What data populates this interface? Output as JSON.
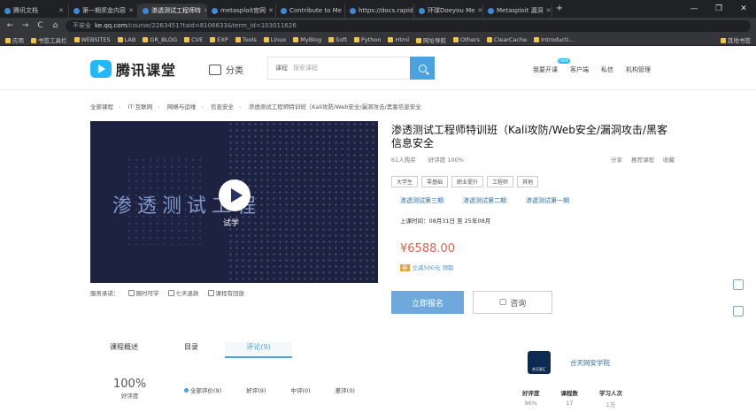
{
  "browser": {
    "tabs": [
      {
        "label": "腾讯文档"
      },
      {
        "label": "第一期奖金内容"
      },
      {
        "label": "渗透测试工程师特"
      },
      {
        "label": "metasploit官网"
      },
      {
        "label": "Contribute to Me"
      },
      {
        "label": "https://docs.rapid"
      },
      {
        "label": "环球Doeyou Me"
      },
      {
        "label": "Metasploit 漏洞"
      }
    ],
    "window_controls": [
      "—",
      "❐",
      "✕"
    ],
    "nav": {
      "back": "←",
      "forward": "→",
      "reload": "C",
      "home": "⌂"
    },
    "address": {
      "not_secure": "不安全",
      "host": "ke.qq.com",
      "path": "/course/2263451?taid=8106633&term_id=103011626"
    },
    "bookmarks": [
      "应用",
      "书签工具栏",
      "WEBSITES",
      "LAB",
      "GR_BLOG",
      "CVE",
      "EXP",
      "Tools",
      "Linux",
      "MyBlog",
      "Soft",
      "Python",
      "Html",
      "网址导航",
      "Others",
      "ClearCache",
      "Introducti…",
      "其他书签"
    ]
  },
  "header": {
    "logo_text": "腾讯课堂",
    "category_label": "分类",
    "search_scope": "课程",
    "search_placeholder": "搜索课程",
    "links": [
      "我要开课",
      "客户端",
      "私信",
      "机构管理"
    ],
    "link_badge": "new"
  },
  "breadcrumb": [
    "全部课程",
    "IT·互联网",
    "网络与运维",
    "信息安全",
    "渗透测试工程师特训班（Kali攻防/Web安全/漏洞攻击/黑客信息安全"
  ],
  "video": {
    "overlay_title": "渗透测试工程",
    "trial_label": "试学"
  },
  "video_footer": [
    "服务承诺：",
    "随时可学",
    "七天退款",
    "课程有回放"
  ],
  "course": {
    "title": "渗透测试工程师特训班（Kali攻防/Web安全/漏洞攻击/黑客信息安全",
    "buyers": "61人购买",
    "rating": "好评度 100%",
    "share": "分享",
    "recommend": "推荐课程",
    "favorite": "收藏",
    "tags": [
      "大学生",
      "零基础",
      "职业提升",
      "工程师",
      "其他"
    ],
    "terms": [
      "渗透测试第三期",
      "渗透测试第二期",
      "渗透测试第一期"
    ],
    "date": "上课时间：08月31日 至 25年08月",
    "price": "¥6588.00",
    "coupon_tag": "券",
    "coupon": "立减500元 领取",
    "buy_button": "立即报名",
    "consult_button": "咨询"
  },
  "content_tabs": {
    "items": [
      "课程概述",
      "目录",
      "评论(9)"
    ],
    "active_index": 2
  },
  "reviews": {
    "percent": "100%",
    "percent_label": "好评度",
    "filters": [
      "全部评价(9)",
      "好评(9)",
      "中评(0)",
      "差评(0)"
    ]
  },
  "org": {
    "emblem_text": "合天智汇",
    "name": "合天网安学院",
    "stats": [
      {
        "label": "好评度",
        "value": "96%"
      },
      {
        "label": "课程数",
        "value": "17"
      },
      {
        "label": "学习人次",
        "value": "1万"
      }
    ]
  },
  "colors": {
    "accent": "#4aa3df",
    "price": "#e85f4e",
    "video_bg": "#1d2240"
  }
}
